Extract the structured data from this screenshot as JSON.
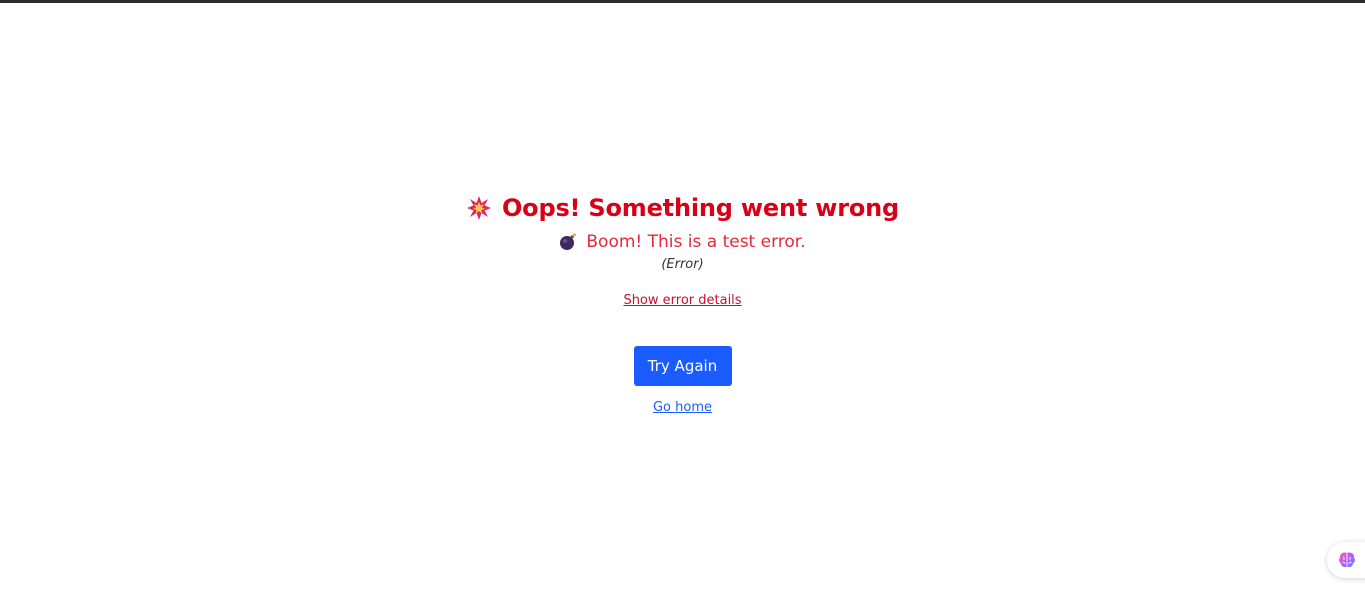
{
  "error": {
    "title_icon": "collision-icon",
    "title": "Oops! Something went wrong",
    "message_icon": "bomb-icon",
    "message": "Boom! This is a test error.",
    "error_type": "(Error)",
    "details_link": "Show error details"
  },
  "actions": {
    "try_again": "Try Again",
    "go_home": "Go home"
  },
  "floating": {
    "assistant_icon": "brain-icon"
  },
  "colors": {
    "title": "#d80016",
    "message": "#e5293a",
    "details_link": "#c8102e",
    "primary": "#1a5cff",
    "top_border": "#2b2b2b"
  }
}
